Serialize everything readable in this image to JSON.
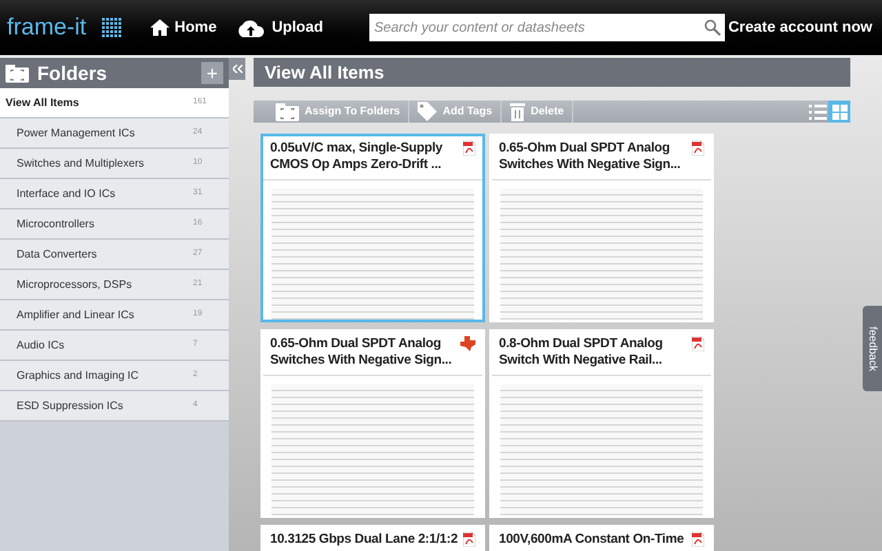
{
  "header": {
    "logo": "frame-it",
    "nav": [
      {
        "label": "Home",
        "kind": "home"
      },
      {
        "label": "Upload",
        "kind": "upload"
      }
    ],
    "search": {
      "placeholder": "Search your content or datasheets"
    },
    "account_link": "Create account now"
  },
  "sidebar": {
    "title": "Folders",
    "add_button": "+",
    "items": [
      {
        "label": "View All Items",
        "count": "161",
        "selected": true
      },
      {
        "label": "Power Management ICs",
        "count": "24",
        "selected": false
      },
      {
        "label": "Switches and Multiplexers",
        "count": "10",
        "selected": false
      },
      {
        "label": "Interface and IO ICs",
        "count": "31",
        "selected": false
      },
      {
        "label": "Microcontrollers",
        "count": "16",
        "selected": false
      },
      {
        "label": "Data Converters",
        "count": "27",
        "selected": false
      },
      {
        "label": "Microprocessors, DSPs",
        "count": "21",
        "selected": false
      },
      {
        "label": "Amplifier and Linear ICs",
        "count": "19",
        "selected": false
      },
      {
        "label": "Audio ICs",
        "count": "7",
        "selected": false
      },
      {
        "label": "Graphics and Imaging IC",
        "count": "2",
        "selected": false
      },
      {
        "label": "ESD Suppression ICs",
        "count": "4",
        "selected": false
      }
    ]
  },
  "main": {
    "title": "View All Items",
    "toolbar": [
      {
        "label": "Assign To Folders",
        "kind": "folder"
      },
      {
        "label": "Add Tags",
        "kind": "tag"
      },
      {
        "label": "Delete",
        "kind": "trash"
      }
    ],
    "view_modes": [
      {
        "kind": "list",
        "selected": false
      },
      {
        "kind": "grid",
        "selected": true
      }
    ],
    "items": [
      {
        "title": "0.05uV/C max, Single-Supply CMOS Op Amps Zero-Drift ...",
        "kind": "pdf",
        "selected": true
      },
      {
        "title": "0.65-Ohm Dual SPDT Analog Switches With Negative Sign...",
        "kind": "pdf",
        "selected": false
      },
      {
        "title": "0.65-Ohm Dual SPDT Analog Switches With Negative Sign...",
        "kind": "web",
        "selected": false
      },
      {
        "title": "0.8-Ohm Dual SPDT Analog Switch With Negative Rail...",
        "kind": "pdf",
        "selected": false
      },
      {
        "title": "10.3125 Gbps Dual Lane 2:1/1:2",
        "kind": "pdf",
        "selected": false
      },
      {
        "title": "100V,600mA Constant On-Time",
        "kind": "pdf",
        "selected": false
      }
    ]
  },
  "feedback_tab": "feedback"
}
